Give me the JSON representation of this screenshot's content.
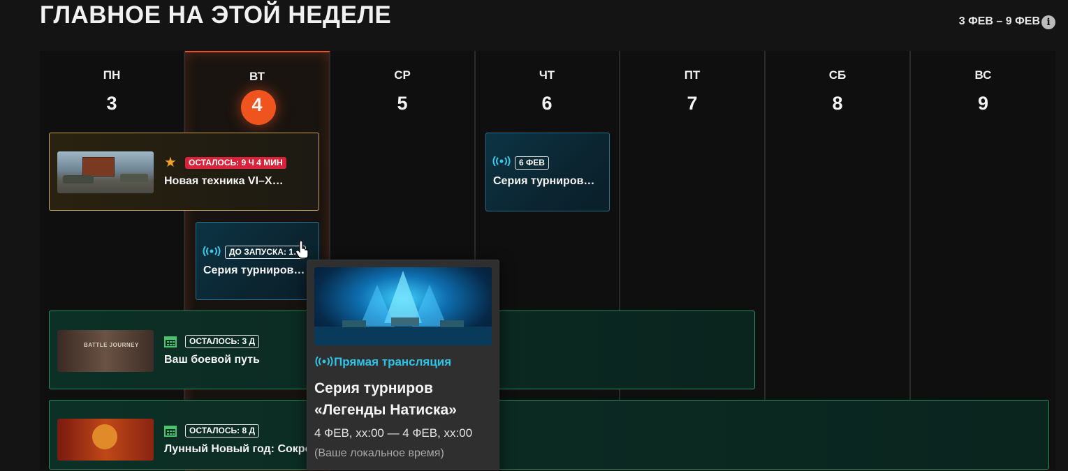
{
  "header": {
    "title": "ГЛАВНОЕ НА ЭТОЙ НЕДЕЛЕ",
    "date_range": "3 ФЕВ – 9 ФЕВ",
    "info_icon": "i"
  },
  "days": [
    {
      "name": "ПН",
      "num": "3"
    },
    {
      "name": "ВТ",
      "num": "4"
    },
    {
      "name": "СР",
      "num": "5"
    },
    {
      "name": "ЧТ",
      "num": "6"
    },
    {
      "name": "ПТ",
      "num": "7"
    },
    {
      "name": "СБ",
      "num": "8"
    },
    {
      "name": "ВС",
      "num": "9"
    }
  ],
  "events": {
    "new_vehicles": {
      "badge": "ОСТАЛОСЬ: 9 Ч 4 МИН",
      "title": "Новая техника VI–X…"
    },
    "tournament_thu": {
      "badge": "6 ФЕВ",
      "title": "Серия турниров…"
    },
    "tournament_tue": {
      "badge": "ДО ЗАПУСКА: 1…",
      "title": "Серия турниров…"
    },
    "battle_journey": {
      "badge": "ОСТАЛОСЬ: 3 Д",
      "title": "Ваш боевой путь",
      "thumb_text": "BATTLE JOURNEY"
    },
    "lunar_new_year": {
      "badge": "ОСТАЛОСЬ: 8 Д",
      "title": "Лунный Новый год: Сокров"
    }
  },
  "tooltip": {
    "live_label": "Прямая трансляция",
    "title_line1": "Серия турниров",
    "title_line2": "«Легенды Натиска»",
    "time": "4 ФЕВ, хх:00 — 4 ФЕВ, хх:00",
    "local_note": "(Ваше локальное время)"
  },
  "colors": {
    "accent_today": "#f0541e",
    "badge_red": "#d8233a",
    "live_cyan": "#2ec4e8",
    "gold_border": "#c7a45a",
    "green_border": "#2c8a5e",
    "blue_border": "#2c6f8a"
  },
  "icons": {
    "star": "star-icon",
    "broadcast": "broadcast-icon",
    "calendar": "calendar-icon",
    "cursor": "hand-cursor-icon"
  }
}
